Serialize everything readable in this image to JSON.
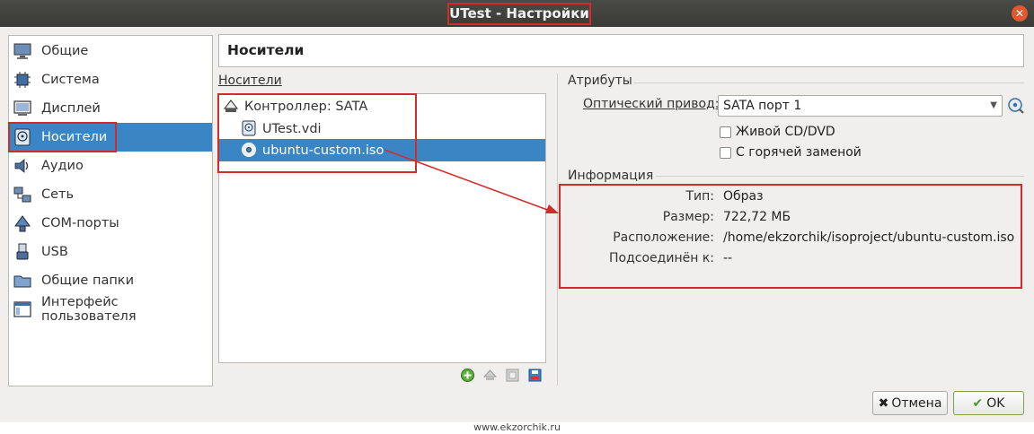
{
  "window": {
    "title": "UTest - Настройки",
    "close_glyph": "✕"
  },
  "sidebar": {
    "items": [
      {
        "label": "Общие",
        "icon": "monitor-icon"
      },
      {
        "label": "Система",
        "icon": "chip-icon"
      },
      {
        "label": "Дисплей",
        "icon": "display-icon"
      },
      {
        "label": "Носители",
        "icon": "disk-icon",
        "active": true
      },
      {
        "label": "Аудио",
        "icon": "speaker-icon"
      },
      {
        "label": "Сеть",
        "icon": "network-icon"
      },
      {
        "label": "COM-порты",
        "icon": "serial-port-icon"
      },
      {
        "label": "USB",
        "icon": "usb-icon"
      },
      {
        "label": "Общие папки",
        "icon": "folder-icon"
      },
      {
        "label": "Интерфейс пользователя",
        "icon": "window-icon"
      }
    ]
  },
  "page": {
    "title": "Носители"
  },
  "storage": {
    "label": "Носители",
    "tree": [
      {
        "label": "Контроллер: SATA",
        "icon": "controller-icon"
      },
      {
        "label": "UTest.vdi",
        "icon": "hard-disk-icon"
      },
      {
        "label": "ubuntu-custom.iso",
        "icon": "optical-disc-icon",
        "selected": true
      }
    ]
  },
  "attributes": {
    "label": "Атрибуты",
    "optical_drive_label": "Оптический привод:",
    "optical_drive_value": "SATA порт 1",
    "live_cd_label": "Живой CD/DVD",
    "live_cd_checked": false,
    "hotplug_label": "С горячей заменой",
    "hotplug_checked": false
  },
  "information": {
    "label": "Информация",
    "rows": [
      {
        "key": "Тип:",
        "value": "Образ"
      },
      {
        "key": "Размер:",
        "value": "722,72 МБ"
      },
      {
        "key": "Расположение:",
        "value": "/home/ekzorchik/isoproject/ubuntu-custom.iso"
      },
      {
        "key": "Подсоединён к:",
        "value": "--"
      }
    ]
  },
  "buttons": {
    "cancel": "Отмена",
    "ok": "OK"
  },
  "footer": {
    "watermark": "www.ekzorchik.ru"
  },
  "colors": {
    "selection": "#3a86c5",
    "annotation": "#d42a2a",
    "titlebar": "#3c3b37"
  }
}
